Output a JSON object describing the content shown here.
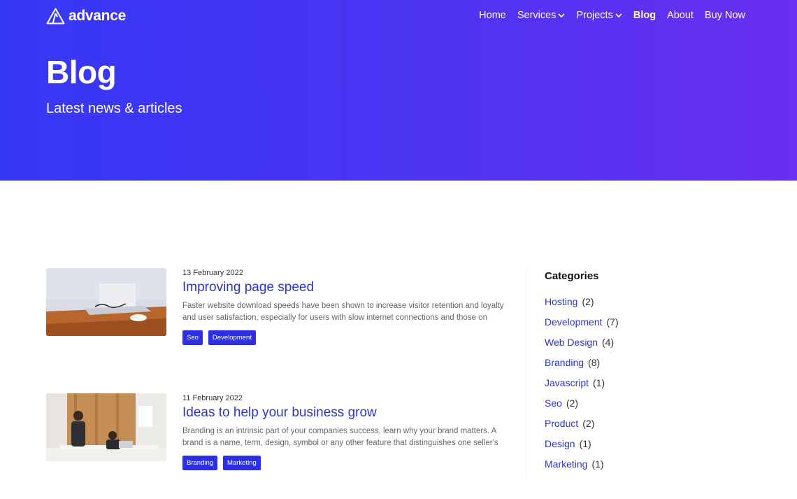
{
  "brand": {
    "name": "advance"
  },
  "nav": {
    "items": [
      {
        "label": "Home",
        "dropdown": false,
        "active": false
      },
      {
        "label": "Services",
        "dropdown": true,
        "active": false
      },
      {
        "label": "Projects",
        "dropdown": true,
        "active": false
      },
      {
        "label": "Blog",
        "dropdown": false,
        "active": true
      },
      {
        "label": "About",
        "dropdown": false,
        "active": false
      },
      {
        "label": "Buy Now",
        "dropdown": false,
        "active": false
      }
    ]
  },
  "hero": {
    "title": "Blog",
    "subtitle": "Latest news & articles"
  },
  "posts": [
    {
      "date": "13 February 2022",
      "title": "Improving page speed",
      "excerpt": "Faster website download speeds have been shown to increase visitor retention and loyalty and user satisfaction, especially for users with slow internet connections and those on mobile devices.",
      "tags": [
        "Seo",
        "Development"
      ]
    },
    {
      "date": "11 February 2022",
      "title": "Ideas to help your business grow",
      "excerpt": "Branding is an intrinsic part of your companies success, learn why your brand matters. A brand is a name, term, design, symbol or any other feature that distinguishes one seller's good or service fro…",
      "tags": [
        "Branding",
        "Marketing"
      ]
    }
  ],
  "sidebar": {
    "title": "Categories",
    "categories": [
      {
        "name": "Hosting",
        "count": "(2)"
      },
      {
        "name": "Development",
        "count": "(7)"
      },
      {
        "name": "Web Design",
        "count": "(4)"
      },
      {
        "name": "Branding",
        "count": "(8)"
      },
      {
        "name": "Javascript",
        "count": "(1)"
      },
      {
        "name": "Seo",
        "count": "(2)"
      },
      {
        "name": "Product",
        "count": "(2)"
      },
      {
        "name": "Design",
        "count": "(1)"
      },
      {
        "name": "Marketing",
        "count": "(1)"
      }
    ]
  },
  "colors": {
    "hero_start": "#3538f5",
    "hero_end": "#6a2ff0",
    "link": "#2a36c9",
    "tag_bg": "#2d2fe6"
  },
  "icons": {
    "logo": "triangle-logo-icon",
    "dropdown": "chevron-down-icon"
  }
}
